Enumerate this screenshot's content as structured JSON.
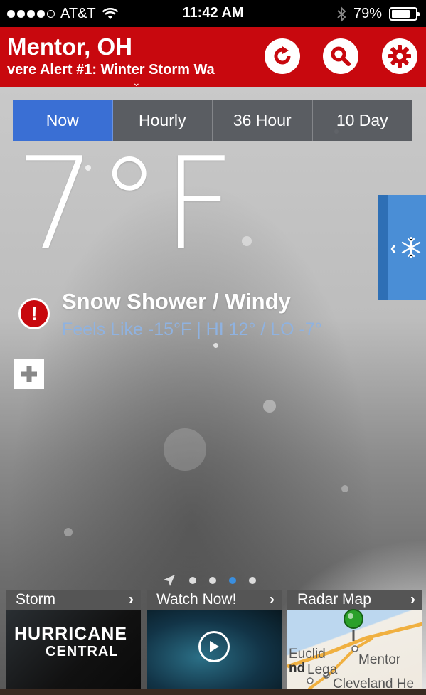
{
  "status_bar": {
    "carrier": "AT&T",
    "time": "11:42 AM",
    "battery": "79%",
    "battery_level": 0.79
  },
  "header": {
    "city": "Mentor, OH",
    "alert": "vere Alert #1: Winter Storm Wa",
    "buttons": [
      "refresh-icon",
      "search-icon",
      "gear-icon"
    ]
  },
  "tabs": [
    {
      "label": "Now",
      "active": true
    },
    {
      "label": "Hourly",
      "active": false
    },
    {
      "label": "36 Hour",
      "active": false
    },
    {
      "label": "10 Day",
      "active": false
    }
  ],
  "current": {
    "temperature": "7°F",
    "condition": "Snow Shower / Windy",
    "feels_like": "Feels Like -15°F | HI 12° / LO -7°"
  },
  "pager": {
    "count": 4,
    "active_index": 2
  },
  "cards": [
    {
      "title": "Storm",
      "line1": "HURRICANE",
      "line2": "CENTRAL"
    },
    {
      "title": "Watch Now!"
    },
    {
      "title": "Radar Map",
      "labels": [
        "Euclid",
        "Mentor",
        "nd",
        "Lega",
        "Cleveland He"
      ]
    }
  ],
  "colors": {
    "header_red": "#c8080e",
    "active_tab": "#3a6fd4",
    "feels_like_blue": "#8fb2e0",
    "side_tab_blue": "#4a8ed6"
  }
}
